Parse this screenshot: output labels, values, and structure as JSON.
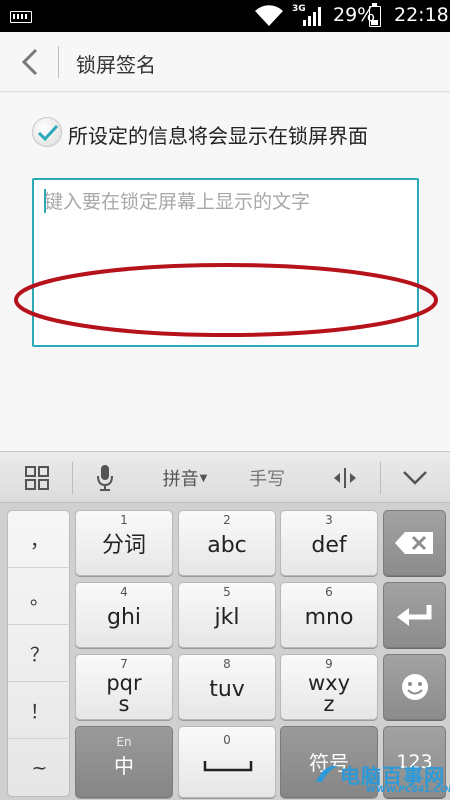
{
  "status_bar": {
    "network": "3G",
    "battery_text": "29%",
    "battery_level": 0.29,
    "time": "22:18"
  },
  "header": {
    "title": "锁屏签名"
  },
  "main": {
    "checkbox_label": "所设定的信息将会显示在锁屏界面",
    "checkbox_checked": true,
    "input_placeholder": "键入要在锁定屏幕上显示的文字",
    "input_value": ""
  },
  "keyboard_toolbar": {
    "pinyin_label": "拼音",
    "handwriting_label": "手写"
  },
  "keyboard": {
    "punctuation": [
      "，",
      "。",
      "？",
      "！",
      "~"
    ],
    "keys": [
      {
        "num": "1",
        "label": "分词"
      },
      {
        "num": "2",
        "label": "abc"
      },
      {
        "num": "3",
        "label": "def"
      },
      {
        "num": "4",
        "label": "ghi"
      },
      {
        "num": "5",
        "label": "jkl"
      },
      {
        "num": "6",
        "label": "mno"
      },
      {
        "num": "7",
        "label": "pqr\ns"
      },
      {
        "num": "8",
        "label": "tuv"
      },
      {
        "num": "9",
        "label": "wxy\nz"
      }
    ],
    "lang_key": {
      "top": "En",
      "label": "中"
    },
    "space_num": "0",
    "symbol_label": "符号",
    "num_label": "123"
  },
  "watermark": {
    "text": "电脑百事网",
    "sub": "WWW.PC841.COM"
  },
  "colors": {
    "accent": "#2aa9b8",
    "annotation": "#b5121b"
  }
}
